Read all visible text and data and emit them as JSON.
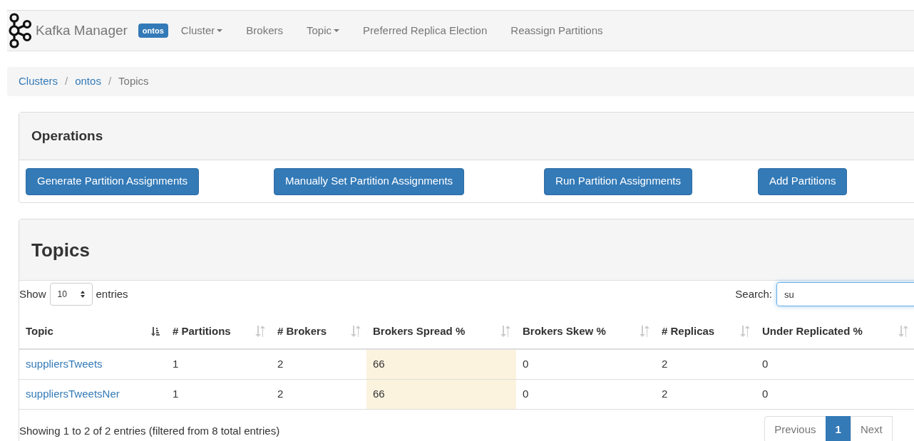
{
  "navbar": {
    "brand": "Kafka Manager",
    "cluster_badge": "ontos",
    "items": [
      {
        "label": "Cluster",
        "dropdown": true
      },
      {
        "label": "Brokers",
        "dropdown": false
      },
      {
        "label": "Topic",
        "dropdown": true
      },
      {
        "label": "Preferred Replica Election",
        "dropdown": false
      },
      {
        "label": "Reassign Partitions",
        "dropdown": false
      }
    ]
  },
  "breadcrumb_separator": "/",
  "breadcrumb": [
    {
      "label": "Clusters",
      "link": true
    },
    {
      "label": "ontos",
      "link": true
    },
    {
      "label": "Topics",
      "link": false
    }
  ],
  "operations": {
    "title": "Operations",
    "buttons": [
      "Generate Partition Assignments",
      "Manually Set Partition Assignments",
      "Run Partition Assignments",
      "Add Partitions"
    ]
  },
  "topics": {
    "title": "Topics",
    "show_label": "Show",
    "page_size": "10",
    "entries_label": "entries",
    "search_label": "Search:",
    "search_value": "su",
    "table": {
      "columns": [
        {
          "label": "Topic",
          "sorted": true,
          "highlighted": false
        },
        {
          "label": "# Partitions",
          "sorted": false,
          "highlighted": false
        },
        {
          "label": "# Brokers",
          "sorted": false,
          "highlighted": false
        },
        {
          "label": "Brokers Spread %",
          "sorted": false,
          "highlighted": true
        },
        {
          "label": "Brokers Skew %",
          "sorted": false,
          "highlighted": false
        },
        {
          "label": "# Replicas",
          "sorted": false,
          "highlighted": false
        },
        {
          "label": "Under Replicated %",
          "sorted": false,
          "highlighted": false
        }
      ],
      "rows": [
        [
          "suppliersTweets",
          "1",
          "2",
          "66",
          "0",
          "2",
          "0"
        ],
        [
          "suppliersTweetsNer",
          "1",
          "2",
          "66",
          "0",
          "2",
          "0"
        ]
      ]
    },
    "info": "Showing 1 to 2 of 2 entries (filtered from 8 total entries)",
    "pagination": [
      {
        "label": "Previous",
        "selected": false
      },
      {
        "label": "1",
        "selected": true
      },
      {
        "label": "Next",
        "selected": false
      }
    ]
  }
}
